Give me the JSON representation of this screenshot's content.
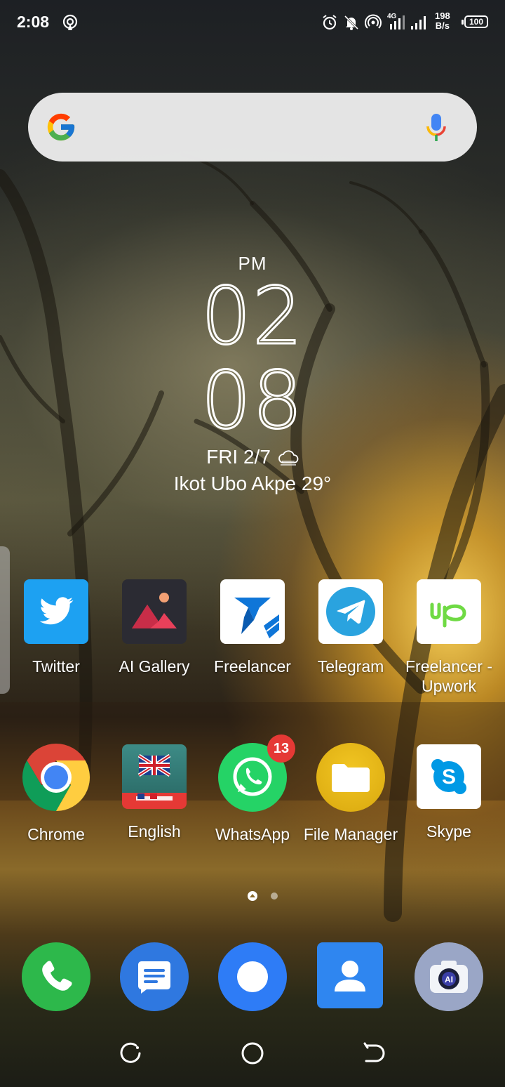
{
  "status_bar": {
    "time": "2:08",
    "net_speed_value": "198",
    "net_speed_unit": "B/s",
    "battery": "100"
  },
  "search": {
    "placeholder": ""
  },
  "clock_widget": {
    "ampm": "PM",
    "hour": "02",
    "minute": "08",
    "date": "FRI 2/7",
    "location_temp": "Ikot Ubo Akpe 29°"
  },
  "apps_row1": [
    {
      "label": "Twitter"
    },
    {
      "label": "AI Gallery"
    },
    {
      "label": "Freelancer"
    },
    {
      "label": "Telegram"
    },
    {
      "label": "Freelancer - Upwork"
    }
  ],
  "apps_row2": [
    {
      "label": "Chrome"
    },
    {
      "label": "English"
    },
    {
      "label": "WhatsApp",
      "badge": "13"
    },
    {
      "label": "File Manager"
    },
    {
      "label": "Skype"
    }
  ],
  "dock": [
    "phone-icon",
    "messages-icon",
    "browser-icon",
    "contacts-icon",
    "camera-icon"
  ],
  "colors": {
    "twitter": "#1DA1F2",
    "telegram": "#2AA3DF",
    "whatsapp": "#25D366",
    "skype": "#0099E5",
    "badge": "#E53935",
    "phone": "#2DB84B",
    "messages": "#2F78E0",
    "browser": "#2E7CF6",
    "contacts": "#2F86F0"
  }
}
